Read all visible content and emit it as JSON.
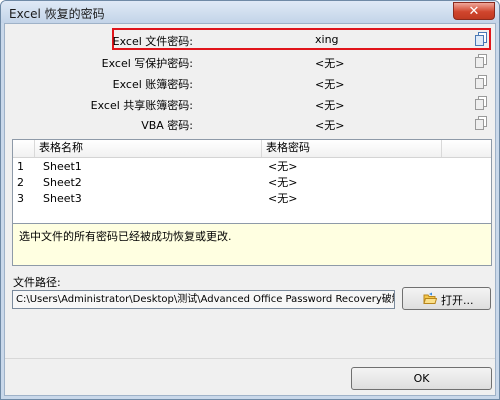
{
  "window": {
    "title": "Excel 恢复的密码",
    "close_glyph": "✕"
  },
  "passwords": [
    {
      "label": "Excel 文件密码:",
      "value": "xing",
      "highlighted": true
    },
    {
      "label": "Excel 写保护密码:",
      "value": "<无>"
    },
    {
      "label": "Excel 账簿密码:",
      "value": "<无>"
    },
    {
      "label": "Excel 共享账簿密码:",
      "value": "<无>"
    },
    {
      "label": "VBA 密码:",
      "value": "<无>"
    }
  ],
  "sheet_table": {
    "columns": [
      "",
      "表格名称",
      "表格密码"
    ],
    "rows": [
      {
        "num": "1",
        "name": "Sheet1",
        "password": "<无>"
      },
      {
        "num": "2",
        "name": "Sheet2",
        "password": "<无>"
      },
      {
        "num": "3",
        "name": "Sheet3",
        "password": "<无>"
      }
    ]
  },
  "status_message": "选中文件的所有密码已经被成功恢复或更改.",
  "file_path": {
    "label": "文件路径:",
    "value": "C:\\Users\\Administrator\\Desktop\\测试\\Advanced Office Password Recovery破解数据.x"
  },
  "buttons": {
    "open": "打开...",
    "ok": "OK"
  },
  "colors": {
    "highlight_border": "#e0151b",
    "status_bg": "#ffffe1",
    "close_button": "#d0452d"
  },
  "icons": {
    "copy": "copy-icon",
    "open": "folder-open-icon"
  }
}
